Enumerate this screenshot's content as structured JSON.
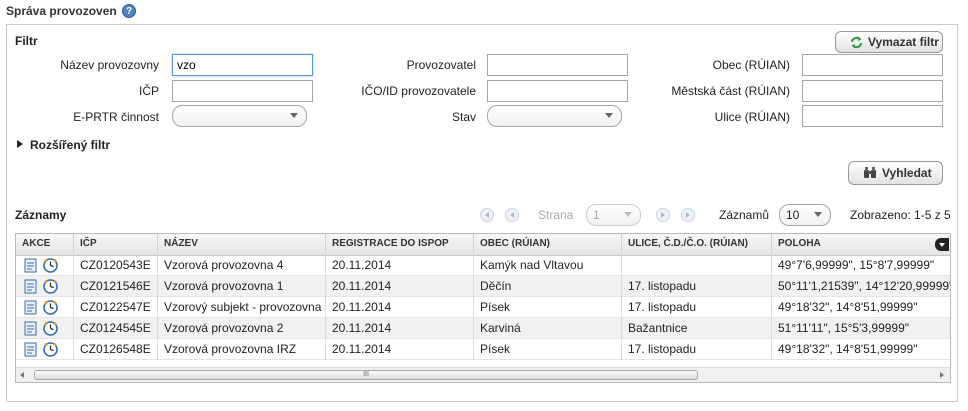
{
  "page": {
    "title": "Správa provozoven",
    "help": "?"
  },
  "filter": {
    "heading": "Filtr",
    "clear_label": "Vymazat filtr",
    "search_label": "Vyhledat",
    "advanced_label": "Rozšířený filtr",
    "fields": {
      "nazev": {
        "label": "Název provozovny",
        "value": "vzo"
      },
      "icp": {
        "label": "IČP",
        "value": ""
      },
      "eprtr": {
        "label": "E-PRTR činnost",
        "value": ""
      },
      "provozovatel": {
        "label": "Provozovatel",
        "value": ""
      },
      "ico": {
        "label": "IČO/ID provozovatele",
        "value": ""
      },
      "stav": {
        "label": "Stav",
        "value": ""
      },
      "obec": {
        "label": "Obec (RÚIAN)",
        "value": ""
      },
      "mestska": {
        "label": "Městská část (RÚIAN)",
        "value": ""
      },
      "ulice": {
        "label": "Ulice (RÚIAN)",
        "value": ""
      }
    }
  },
  "records": {
    "heading": "Záznamy",
    "page_label": "Strana",
    "page_value": "1",
    "count_label": "Záznamů",
    "count_value": "10",
    "shown": "Zobrazeno: 1-5 z 5",
    "columns": [
      "AKCE",
      "IČP",
      "NÁZEV",
      "REGISTRACE DO ISPOP",
      "OBEC (RÚIAN)",
      "ULICE, Č.D./Č.O. (RÚIAN)",
      "POLOHA"
    ],
    "rows": [
      {
        "icp": "CZ0120543E",
        "nazev": "Vzorová provozovna 4",
        "reg": "20.11.2014",
        "obec": "Kamýk nad Vltavou",
        "ulice": "",
        "poloha": "49°7'6,99999\", 15°8'7,99999\""
      },
      {
        "icp": "CZ0121546E",
        "nazev": "Vzorová provozovna 1",
        "reg": "20.11.2014",
        "obec": "Děčín",
        "ulice": "17. listopadu",
        "poloha": "50°11'1,21539\", 14°12'20,99999\""
      },
      {
        "icp": "CZ0122547E",
        "nazev": "Vzorový subjekt - provozovna",
        "reg": "20.11.2014",
        "obec": "Písek",
        "ulice": "17. listopadu",
        "poloha": "49°18'32\", 14°8'51,99999\""
      },
      {
        "icp": "CZ0124545E",
        "nazev": "Vzorová provozovna 2",
        "reg": "20.11.2014",
        "obec": "Karviná",
        "ulice": "Bažantnice",
        "poloha": "51°11'11\", 15°5'3,99999\""
      },
      {
        "icp": "CZ0126548E",
        "nazev": "Vzorová provozovna IRZ",
        "reg": "20.11.2014",
        "obec": "Písek",
        "ulice": "17. listopadu",
        "poloha": "49°18'32\", 14°8'51,99999\""
      }
    ],
    "scroll_grip": "III"
  },
  "icons": {
    "clear": "refresh-icon",
    "search": "binoculars-icon",
    "doc": "document-icon",
    "clock": "clock-icon",
    "expand": "triangle-right-icon"
  },
  "colors": {
    "accent": "#4a86c5",
    "focus_border": "#5b9bd5"
  }
}
